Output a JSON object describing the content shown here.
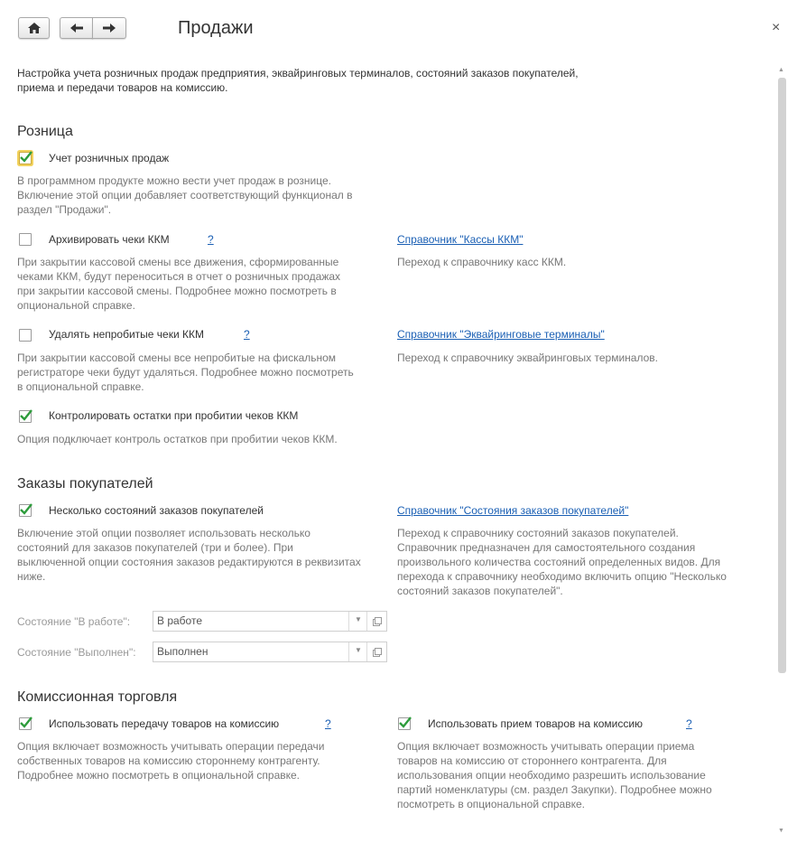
{
  "header": {
    "title": "Продажи",
    "close_glyph": "×",
    "description_line1": "Настройка учета розничных продаж предприятия, эквайринговых терминалов, состояний заказов покупателей,",
    "description_line2": "приема и передачи товаров на комиссию."
  },
  "retail": {
    "heading": "Розница",
    "retail_sales": {
      "label": "Учет розничных продаж",
      "checked": true,
      "hint_line1": "В программном продукте можно вести учет продаж в рознице.",
      "hint_line2": "Включение этой опции добавляет соответствующий функционал в",
      "hint_line3": "раздел \"Продажи\"."
    },
    "archive_receipts": {
      "label": "Архивировать чеки ККМ",
      "help": "?",
      "checked": false,
      "hint_line1": "При закрытии кассовой смены все движения, сформированные",
      "hint_line2": "чеками ККМ, будут переноситься в отчет о розничных продажах",
      "hint_line3": "при закрытии кассовой смены. Подробнее можно посмотреть в",
      "hint_line4": "опциональной справке."
    },
    "cash_registers_link": {
      "label": "Справочник \"Кассы ККМ\"",
      "hint": "Переход к справочнику касс ККМ."
    },
    "delete_unpunched": {
      "label": "Удалять непробитые чеки ККМ",
      "help": "?",
      "checked": false,
      "hint_line1": "При закрытии кассовой смены все непробитые на фискальном",
      "hint_line2": "регистраторе чеки будут удаляться. Подробнее можно посмотреть",
      "hint_line3": "в опциональной справке."
    },
    "acquiring_link": {
      "label": "Справочник \"Эквайринговые терминалы\"",
      "hint": "Переход к справочнику эквайринговых терминалов."
    },
    "control_stock": {
      "label": "Контролировать остатки при пробитии чеков ККМ",
      "checked": true,
      "hint": "Опция подключает контроль остатков при пробитии чеков ККМ."
    }
  },
  "orders": {
    "heading": "Заказы покупателей",
    "multi_states": {
      "label": "Несколько состояний заказов покупателей",
      "checked": true,
      "hint_line1": "Включение этой опции позволяет использовать несколько",
      "hint_line2": "состояний для заказов покупателей (три и более). При",
      "hint_line3": "выключенной опции состояния заказов редактируются в реквизитах",
      "hint_line4": "ниже."
    },
    "states_link": {
      "label": "Справочник \"Состояния заказов покупателей\"",
      "hint_line1": "Переход к справочнику состояний заказов покупателей.",
      "hint_line2": "Справочник предназначен для самостоятельного создания",
      "hint_line3": "произвольного количества состояний определенных видов. Для",
      "hint_line4": "перехода к справочнику необходимо включить опцию \"Несколько",
      "hint_line5": "состояний заказов покупателей\"."
    },
    "in_work": {
      "label": "Состояние \"В работе\":",
      "value": "В работе"
    },
    "done": {
      "label": "Состояние \"Выполнен\":",
      "value": "Выполнен"
    }
  },
  "commission": {
    "heading": "Комиссионная торговля",
    "transfer": {
      "label": "Использовать передачу товаров на комиссию",
      "help": "?",
      "checked": true,
      "hint_line1": "Опция включает возможность учитывать операции передачи",
      "hint_line2": "собственных товаров на комиссию стороннему контрагенту.",
      "hint_line3": "Подробнее можно посмотреть в опциональной справке."
    },
    "receive": {
      "label": "Использовать прием товаров на комиссию",
      "help": "?",
      "checked": true,
      "hint_line1": "Опция включает возможность учитывать операции приема",
      "hint_line2": "товаров на комиссию от стороннего контрагента. Для",
      "hint_line3": "использования опции необходимо разрешить использование",
      "hint_line4": "партий номенклатуры (см. раздел Закупки). Подробнее можно",
      "hint_line5": "посмотреть в опциональной справке."
    }
  },
  "icons": {
    "home": "home-icon",
    "back": "arrow-left-icon",
    "forward": "arrow-right-icon",
    "check": "checkmark-icon"
  },
  "colors": {
    "link": "#1a5fb4",
    "check": "#2e9c3c",
    "hint": "#777777",
    "focus": "#f2d25d"
  }
}
